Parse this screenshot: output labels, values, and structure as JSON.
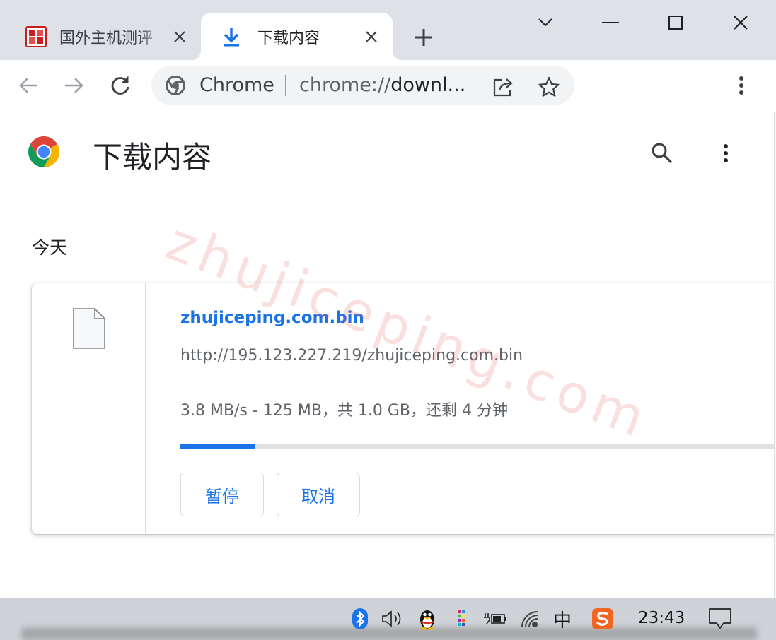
{
  "tabs": [
    {
      "title": "国外主机测评",
      "favicon": "site-seal-icon",
      "active": false
    },
    {
      "title": "下载内容",
      "favicon": "download-arrow-icon",
      "active": true
    }
  ],
  "window_controls": [
    "tab-search-chevron-icon",
    "minimize-icon",
    "maximize-icon",
    "close-icon"
  ],
  "toolbar": {
    "origin_label": "Chrome",
    "url_prefix": "chrome://",
    "url_rest": "downl..."
  },
  "page": {
    "title": "下载内容",
    "date_heading": "今天",
    "watermark": "zhujiceping.com"
  },
  "download": {
    "file_name": "zhujiceping.com.bin",
    "url": "http://195.123.227.219/zhujiceping.com.bin",
    "status": "3.8 MB/s - 125 MB，共 1.0 GB，还剩 4 分钟",
    "progress": 0.125,
    "pause_label": "暂停",
    "cancel_label": "取消"
  },
  "taskbar": {
    "ime_label": "中",
    "clock": "23:43"
  },
  "colors": {
    "accent": "#1a73e8",
    "tabstrip": "#dee1e6",
    "taskbar": "#cfd2d7"
  }
}
